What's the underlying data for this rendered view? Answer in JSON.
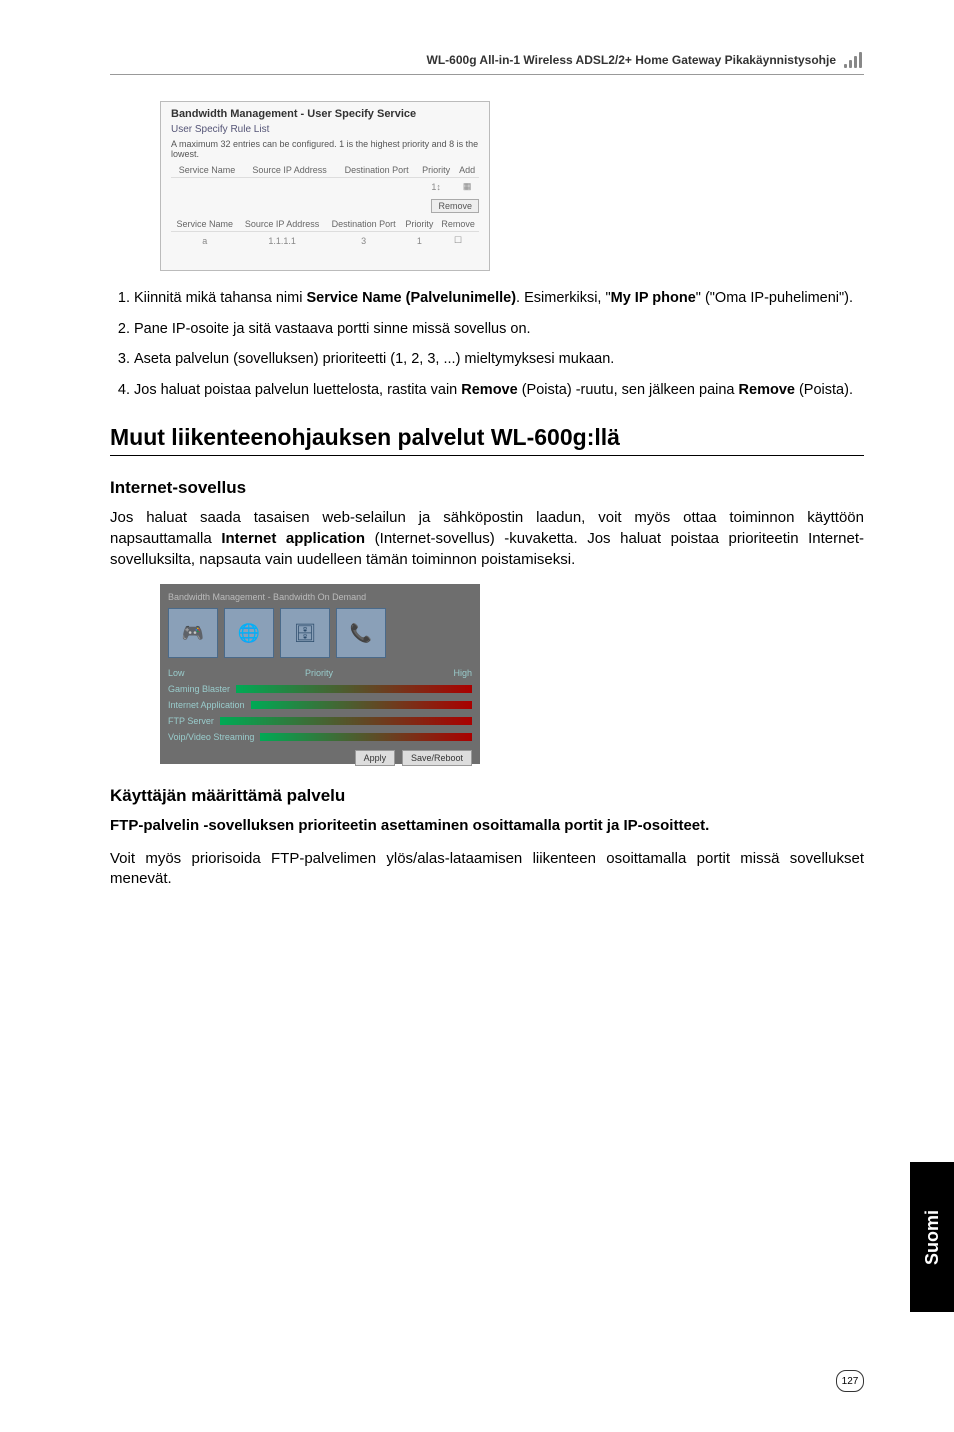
{
  "header": {
    "title": "WL-600g All-in-1 Wireless ADSL2/2+ Home Gateway Pikakäynnistysohje"
  },
  "screenshot1": {
    "title": "Bandwidth Management - User Specify Service",
    "sub": "User Specify Rule List",
    "desc": "A maximum 32 entries can be configured. 1 is the highest priority and 8 is the lowest.",
    "headers": [
      "Service Name",
      "Source IP Address",
      "Destination Port",
      "Priority",
      "Add"
    ],
    "row2_headers": [
      "Service Name",
      "Source IP Address",
      "Destination Port",
      "Priority",
      "Remove"
    ],
    "row2_values": [
      "a",
      "1.1.1.1",
      "3",
      "1",
      ""
    ],
    "remove_btn": "Remove"
  },
  "steps": [
    {
      "prefix": "Kiinnitä mikä tahansa nimi ",
      "bold1": "Service Name (Palvelunimelle)",
      "mid": ". Esimerkiksi, \"",
      "bold2": "My IP phone",
      "suffix": "\" (\"Oma IP-puhelimeni\")."
    },
    {
      "text": "Pane IP-osoite ja sitä vastaava portti sinne missä sovellus on."
    },
    {
      "text": "Aseta palvelun (sovelluksen) prioriteetti (1, 2, 3, ...) mieltymyksesi mukaan."
    },
    {
      "prefix": "Jos haluat poistaa palvelun luettelosta, rastita vain ",
      "bold1": "Remove",
      "mid": " (Poista) -ruutu, sen jälkeen paina ",
      "bold2": "Remove",
      "suffix": " (Poista)."
    }
  ],
  "section_title": "Muut liikenteenohjauksen palvelut WL-600g:llä",
  "subsection1": {
    "title": "Internet-sovellus",
    "body_pre": "Jos haluat saada tasaisen web-selailun ja sähköpostin laadun, voit myös ottaa toiminnon käyttöön napsauttamalla ",
    "body_bold": "Internet application",
    "body_post": " (Internet-sovellus) -kuvaketta. Jos haluat poistaa prioriteetin Internet-sovelluksilta, napsauta vain uudelleen tämän toiminnon poistamiseksi."
  },
  "screenshot2": {
    "title": "Bandwidth Management - Bandwidth On Demand",
    "labels": [
      "Gaming Blaster",
      "Internet Application",
      "FTP Server",
      "Voip/Video Streaming"
    ],
    "low": "Low",
    "priority": "Priority",
    "high": "High",
    "apply": "Apply",
    "save": "Save/Reboot"
  },
  "subsection2": {
    "title": "Käyttäjän määrittämä palvelu",
    "bold_para": "FTP-palvelin -sovelluksen prioriteetin asettaminen osoittamalla portit ja IP-osoitteet.",
    "body": "Voit myös priorisoida FTP-palvelimen ylös/alas-lataamisen liikenteen osoittamalla portit missä sovellukset menevät."
  },
  "side_tab": "Suomi",
  "page_number": "127"
}
